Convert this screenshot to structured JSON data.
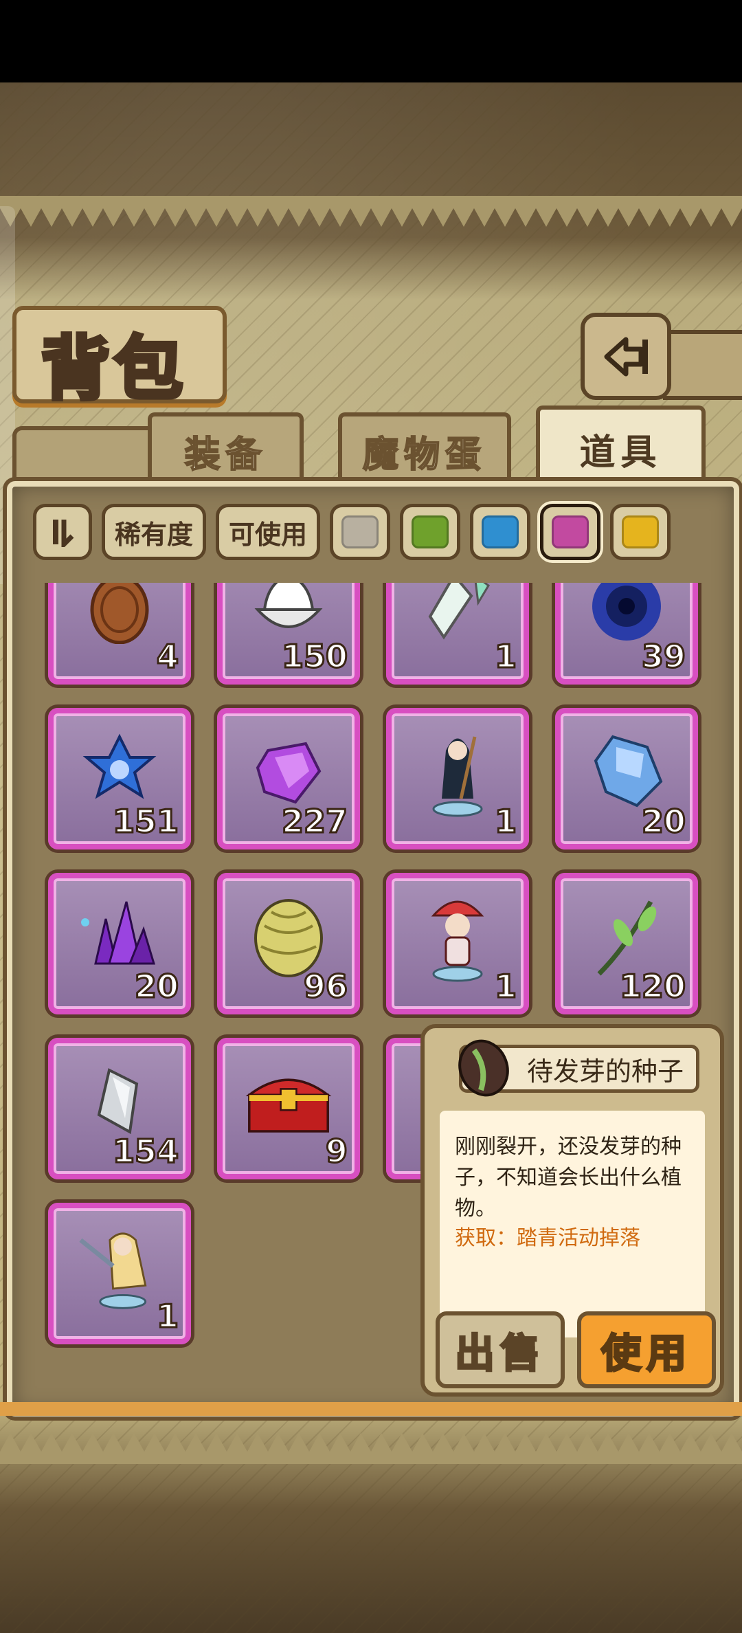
{
  "title": "背包",
  "tabs": [
    {
      "label": "装备",
      "active": false
    },
    {
      "label": "魔物蛋",
      "active": false
    },
    {
      "label": "道具",
      "active": true
    }
  ],
  "filters": {
    "toggle_icon": "sort-toggle-icon",
    "rarity_label": "稀有度",
    "usable_label": "可使用",
    "swatches": [
      {
        "name": "gray",
        "color": "#b8b0a0",
        "selected": false
      },
      {
        "name": "green",
        "color": "#6fa12c",
        "selected": false
      },
      {
        "name": "blue",
        "color": "#2f8fd0",
        "selected": false
      },
      {
        "name": "purple",
        "color": "#c24aa0",
        "selected": true
      },
      {
        "name": "gold",
        "color": "#e5b41e",
        "selected": false
      }
    ]
  },
  "items": [
    {
      "icon": "bronze-coin-icon",
      "count": "4"
    },
    {
      "icon": "whipped-cream-icon",
      "count": "150"
    },
    {
      "icon": "rainbow-crystal-icon",
      "count": "1"
    },
    {
      "icon": "dark-vortex-icon",
      "count": "39"
    },
    {
      "icon": "blue-star-gem-icon",
      "count": "151"
    },
    {
      "icon": "purple-gem-icon",
      "count": "227"
    },
    {
      "icon": "witch-figurine-icon",
      "count": "1"
    },
    {
      "icon": "ice-crystal-icon",
      "count": "20"
    },
    {
      "icon": "amethyst-cluster-icon",
      "count": "20"
    },
    {
      "icon": "hop-cone-icon",
      "count": "96"
    },
    {
      "icon": "mushroom-girl-figurine-icon",
      "count": "1"
    },
    {
      "icon": "sprout-branch-icon",
      "count": "120"
    },
    {
      "icon": "silver-shard-icon",
      "count": "154"
    },
    {
      "icon": "treasure-chest-icon",
      "count": "9"
    },
    {
      "icon": "hidden-item-icon",
      "count": ""
    },
    {
      "icon": "sword-maiden-figurine-icon",
      "count": "1"
    }
  ],
  "popup": {
    "item_name": "待发芽的种子",
    "item_icon": "seed-icon",
    "description": "刚刚裂开，还没发芽的种子，不知道会长出什么植物。",
    "source": "获取：踏青活动掉落",
    "sell_label": "出售",
    "use_label": "使用"
  },
  "colors": {
    "rarity_border": "#d84fc1",
    "use_button": "#f5a030",
    "source_text": "#d06a10"
  }
}
